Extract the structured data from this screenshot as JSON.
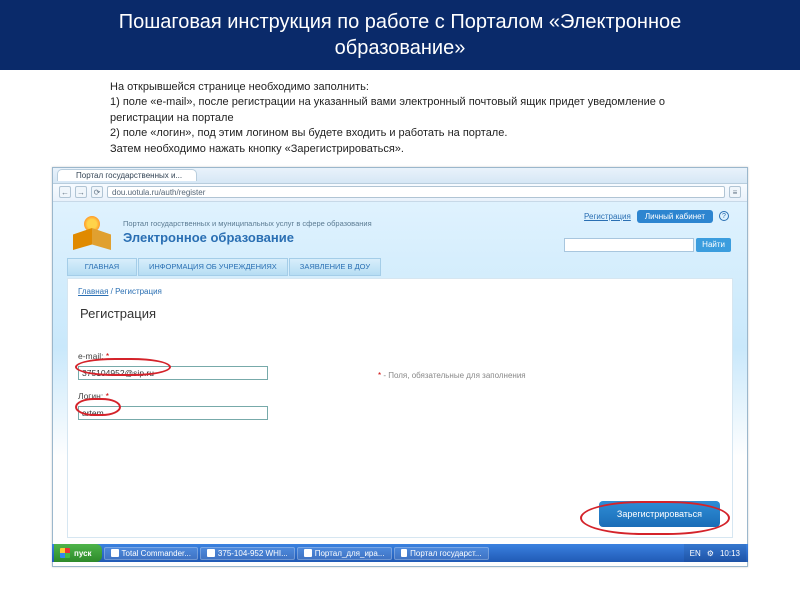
{
  "slide": {
    "title": "Пошаговая инструкция по работе с Порталом «Электронное образование»",
    "instructions_intro": "На открывшейся странице необходимо заполнить:",
    "instructions_1": "1)  поле «e-mail», после регистрации на указанный вами электронный почтовый ящик придет уведомление о регистрации на портале",
    "instructions_2": "2) поле «логин», под этим логином вы будете входить и работать на портале.",
    "instructions_outro": "Затем необходимо нажать кнопку «Зарегистрироваться»."
  },
  "browser": {
    "tab_title": "Портал государственных и...",
    "url": "dou.uotula.ru/auth/register",
    "window_controls": {
      "min": "–",
      "max": "□",
      "close": "×"
    }
  },
  "portal": {
    "top_links": {
      "register": "Регистрация",
      "cabinet": "Личный кабинет"
    },
    "subtitle": "Портал государственных и муниципальных услуг в сфере образования",
    "title": "Электронное образование",
    "search_btn": "Найти",
    "nav": [
      "ГЛАВНАЯ",
      "ИНФОРМАЦИЯ ОБ УЧРЕЖДЕНИЯХ",
      "ЗАЯВЛЕНИЕ В ДОУ"
    ],
    "breadcrumb_home": "Главная",
    "breadcrumb_current": "Регистрация",
    "heading": "Регистрация",
    "hint": "Поля, обязательные для заполнения",
    "form": {
      "email_label": "e-mail:",
      "email_value": "375104952@sip.ru",
      "login_label": "Логин:",
      "login_value": "artem"
    },
    "submit": "Зарегистрироваться"
  },
  "taskbar": {
    "start": "пуск",
    "items": [
      "Total Commander...",
      "375-104-952 WHI...",
      "Портал_для_ира...",
      "Портал государст..."
    ],
    "lang": "EN",
    "time": "10:13"
  }
}
